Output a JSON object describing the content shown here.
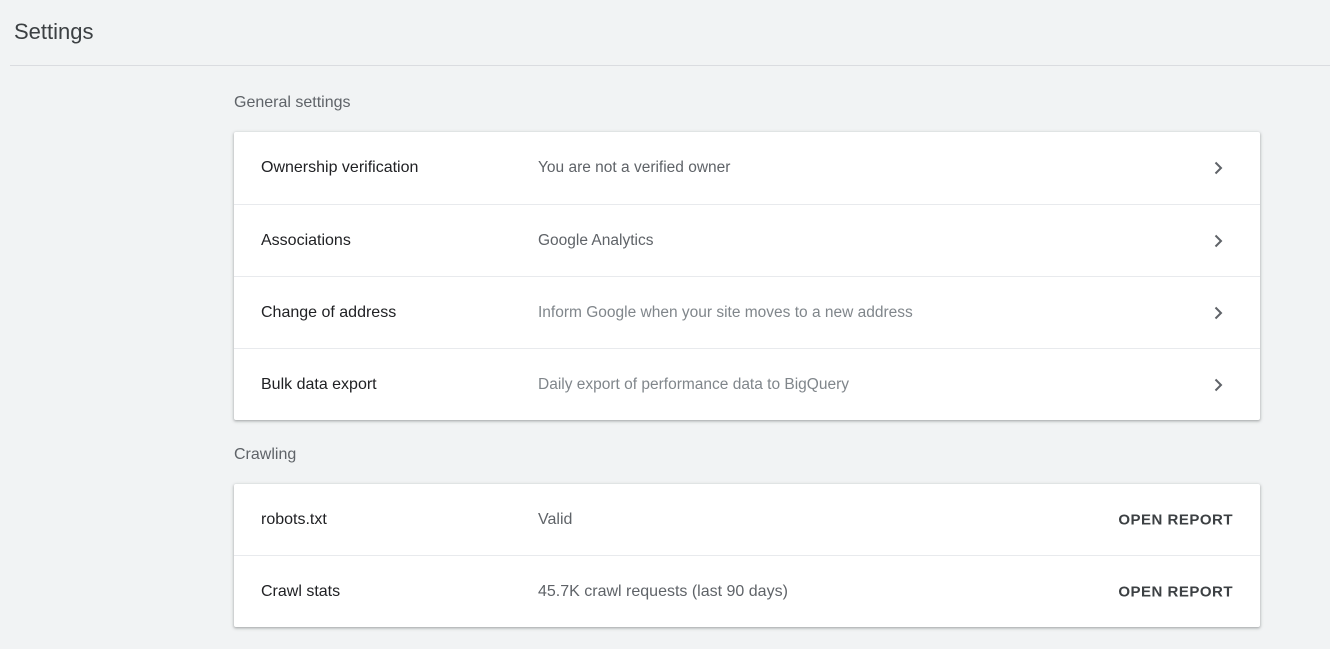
{
  "header": {
    "title": "Settings"
  },
  "general": {
    "label": "General settings",
    "items": [
      {
        "title": "Ownership verification",
        "description": "You are not a verified owner",
        "icon": "chevron-right-icon"
      },
      {
        "title": "Associations",
        "description": "Google Analytics",
        "icon": "chevron-right-icon"
      },
      {
        "title": "Change of address",
        "description": "Inform Google when your site moves to a new address",
        "icon": "chevron-right-icon"
      },
      {
        "title": "Bulk data export",
        "description": "Daily export of performance data to BigQuery",
        "icon": "chevron-right-icon"
      }
    ]
  },
  "crawling": {
    "label": "Crawling",
    "items": [
      {
        "title": "robots.txt",
        "description": "Valid",
        "action": "OPEN REPORT"
      },
      {
        "title": "Crawl stats",
        "description": "45.7K crawl requests (last 90 days)",
        "action": "OPEN REPORT"
      }
    ]
  },
  "colors": {
    "background": "#f1f3f4",
    "card": "#ffffff",
    "text_primary": "#202124",
    "text_secondary": "#5f6368"
  }
}
